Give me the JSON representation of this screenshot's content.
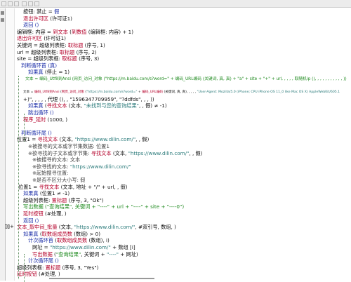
{
  "editor": {
    "fold_marker": "加+",
    "colors": {
      "keyword": "#111111",
      "function": "#b4002a",
      "flow": "#1d2fa8",
      "comment_green": "#1e8a1e",
      "string": "#2a7a7a"
    },
    "lines": [
      {
        "i": 11,
        "s": [
          {
            "t": "按钮: 禁止 = ",
            "c": "k"
          },
          {
            "t": "假",
            "c": "b"
          }
        ]
      },
      {
        "i": 11,
        "s": [
          {
            "t": "退出许可区",
            "c": "f"
          },
          {
            "t": " (许可证1)",
            "c": "k"
          }
        ]
      },
      {
        "i": 11,
        "s": [
          {
            "t": "返回 ()",
            "c": "b"
          }
        ]
      },
      {
        "i": 2,
        "s": [
          {
            "t": "编辑框: 内容 = ",
            "c": "k"
          },
          {
            "t": "到文本",
            "c": "f"
          },
          {
            "t": " (",
            "c": "k"
          },
          {
            "t": "到数值",
            "c": "f"
          },
          {
            "t": " (编辑框: 内容) + 1)",
            "c": "k"
          }
        ]
      },
      {
        "i": 2,
        "s": [
          {
            "t": "退出许可区",
            "c": "f"
          },
          {
            "t": " (许可证1)",
            "c": "k"
          }
        ]
      },
      {
        "i": 2,
        "s": [
          {
            "t": "关键词 = 超级列表框: ",
            "c": "k"
          },
          {
            "t": "取标题",
            "c": "f"
          },
          {
            "t": " (序号, 1)",
            "c": "k"
          }
        ]
      },
      {
        "i": 2,
        "s": [
          {
            "t": "url = 超级列表框: ",
            "c": "k"
          },
          {
            "t": "取标题",
            "c": "f"
          },
          {
            "t": " (序号, 2)",
            "c": "k"
          }
        ]
      },
      {
        "i": 2,
        "s": [
          {
            "t": "site = 超级列表框: ",
            "c": "k"
          },
          {
            "t": "取标题",
            "c": "f"
          },
          {
            "t": " (序号, 3)",
            "c": "k"
          }
        ]
      },
      {
        "i": 8,
        "s": [
          {
            "t": "判断循环首 (真)",
            "c": "b"
          }
        ]
      },
      {
        "i": 18,
        "s": [
          {
            "t": "如果真",
            "c": "b"
          },
          {
            "t": " (停止 = 1)",
            "c": "k"
          }
        ]
      },
      {
        "i": 14,
        "s": [
          {
            "t": "文本 = 编码_Utf8到Ansi (网页_访问_对象 (\"https://m.baidu.com/s?word=\" + 编码_URL编码 (关键词, 真, 真) + \"a\" + site + \"+\" + url, , , , , 取随机ip (), , , , , , , , , , , ))",
            "c": "g"
          }
        ]
      },
      {
        "i": 0,
        "s": []
      },
      {
        "i": 11,
        "s": [
          {
            "t": "文本 = ",
            "c": "k"
          },
          {
            "t": "编码_Utf8到Ansi",
            "c": "f"
          },
          {
            "t": " (",
            "c": "k"
          },
          {
            "t": "网页_访问_对象",
            "c": "f"
          },
          {
            "t": " (",
            "c": "k"
          },
          {
            "t": "\"https://m.baidu.com/s?word=\"",
            "c": "s"
          },
          {
            "t": " + ",
            "c": "k"
          },
          {
            "t": "编码_URL编码",
            "c": "f"
          },
          {
            "t": " (关键词, 真, 真), , , , , ",
            "c": "k"
          },
          {
            "t": "\"User-Agent: Mozilla/5.0 (iPhone; CPU iPhone OS 11_0 like Mac OS X) AppleWebKit/605.1",
            "c": "s"
          }
        ]
      },
      {
        "i": 11,
        "s": [
          {
            "t": "+)\", , , , , 代理 (), , \"1596347709959\", \"?ddfds\", , , ))",
            "c": "k"
          }
        ]
      },
      {
        "i": 18,
        "s": [
          {
            "t": "如果真",
            "c": "b"
          },
          {
            "t": " (",
            "c": "k"
          },
          {
            "t": "寻找文本",
            "c": "f"
          },
          {
            "t": " (文本, ",
            "c": "k"
          },
          {
            "t": "\"未找到与您的查询结果\"",
            "c": "s"
          },
          {
            "t": ", , 假) ≠ -1)",
            "c": "k"
          }
        ]
      },
      {
        "i": 18,
        "s": [
          {
            "t": "跳出循环 ()",
            "c": "b"
          }
        ]
      },
      {
        "i": 11,
        "s": [
          {
            "t": "程序_延时",
            "c": "f"
          },
          {
            "t": " (1000, )",
            "c": "k"
          }
        ]
      },
      {
        "i": 0,
        "s": []
      },
      {
        "i": 8,
        "s": [
          {
            "t": "判断循环尾 ()",
            "c": "b"
          }
        ]
      },
      {
        "i": 2,
        "s": [
          {
            "t": "位置1 = ",
            "c": "k"
          },
          {
            "t": "寻找文本",
            "c": "f"
          },
          {
            "t": " (文本, ",
            "c": "k"
          },
          {
            "t": "\"https://www.dilin.com/\"",
            "c": "s"
          },
          {
            "t": ", , 假)",
            "c": "k"
          }
        ]
      },
      {
        "i": 18,
        "s": [
          {
            "t": "※被搜寻的文本或字节集数据: 位置1",
            "c": "cm"
          }
        ]
      },
      {
        "i": 18,
        "s": [
          {
            "t": "※欲寻找的子文本或字节集: ",
            "c": "cm"
          },
          {
            "t": "寻找文本",
            "c": "f"
          },
          {
            "t": " (文本, ",
            "c": "k"
          },
          {
            "t": "\"https://www.dilin.com/\"",
            "c": "s"
          },
          {
            "t": ", , 假)",
            "c": "k"
          }
        ]
      },
      {
        "i": 24,
        "s": [
          {
            "t": "※被搜寻的文本: 文本",
            "c": "cm"
          }
        ]
      },
      {
        "i": 24,
        "s": [
          {
            "t": "※欲寻找的文本: ",
            "c": "cm"
          },
          {
            "t": "\"https://www.dilin.com/\"",
            "c": "s"
          }
        ]
      },
      {
        "i": 24,
        "s": [
          {
            "t": "※起始搜寻位置:",
            "c": "cm"
          }
        ]
      },
      {
        "i": 24,
        "s": [
          {
            "t": "※是否不区分大小写: 假",
            "c": "cm"
          }
        ]
      },
      {
        "i": 4,
        "s": [
          {
            "t": "位置1 = ",
            "c": "k"
          },
          {
            "t": "寻找文本",
            "c": "f"
          },
          {
            "t": " (文本, 地址 + \"/\" + url, , 假)",
            "c": "k"
          }
        ]
      },
      {
        "i": 11,
        "s": [
          {
            "t": "如果真",
            "c": "b"
          },
          {
            "t": " (位置1 ≠ -1)",
            "c": "k"
          }
        ]
      },
      {
        "i": 11,
        "s": [
          {
            "t": "超级列表框: ",
            "c": "k"
          },
          {
            "t": "置标题",
            "c": "f"
          },
          {
            "t": " (序号, 3, \"Ok\")",
            "c": "k"
          }
        ]
      },
      {
        "i": 11,
        "s": [
          {
            "t": "写出数据 (\"查询结果\", 关键词 + \"----\" + url + \"----\" + site + \"----0\")",
            "c": "g"
          }
        ]
      },
      {
        "i": 11,
        "s": [
          {
            "t": "延时按钮",
            "c": "f"
          },
          {
            "t": " (#处理, )",
            "c": "k"
          }
        ]
      },
      {
        "i": 11,
        "s": [
          {
            "t": "返回 ()",
            "c": "b"
          }
        ]
      },
      {
        "i": 2,
        "s": [
          {
            "t": "文本_取中间_批量",
            "c": "f"
          },
          {
            "t": " (文本, ",
            "c": "k"
          },
          {
            "t": "\"https://www.dilin.com/\"",
            "c": "s"
          },
          {
            "t": ", #双引号, 数组, )",
            "c": "k"
          }
        ]
      },
      {
        "i": 11,
        "s": [
          {
            "t": "如果真",
            "c": "b"
          },
          {
            "t": " (",
            "c": "k"
          },
          {
            "t": "取数组成员数",
            "c": "f"
          },
          {
            "t": " (数组) > 0)",
            "c": "k"
          }
        ]
      },
      {
        "i": 18,
        "s": [
          {
            "t": "计次循环首",
            "c": "b"
          },
          {
            "t": " (",
            "c": "k"
          },
          {
            "t": "取数组成员数",
            "c": "f"
          },
          {
            "t": " (数组), i)",
            "c": "k"
          }
        ]
      },
      {
        "i": 24,
        "s": [
          {
            "t": "网址 = ",
            "c": "k"
          },
          {
            "t": "\"https://www.dilin.com/\"",
            "c": "s"
          },
          {
            "t": " + 数组 [i]",
            "c": "k"
          }
        ]
      },
      {
        "i": 24,
        "s": [
          {
            "t": "写出数据",
            "c": "f"
          },
          {
            "t": " (",
            "c": "k"
          },
          {
            "t": "\"查询结果\"",
            "c": "g"
          },
          {
            "t": ", 关键词 + ",
            "c": "k"
          },
          {
            "t": "\"----\"",
            "c": "s"
          },
          {
            "t": " + 网址)",
            "c": "k"
          }
        ]
      },
      {
        "i": 18,
        "s": [
          {
            "t": "计次循环尾 ()",
            "c": "b"
          }
        ]
      },
      {
        "i": 2,
        "s": [
          {
            "t": "超级列表框: ",
            "c": "k"
          },
          {
            "t": "置标题",
            "c": "f"
          },
          {
            "t": " (序号, 3, \"Yes\")",
            "c": "k"
          }
        ]
      },
      {
        "i": 2,
        "s": [
          {
            "t": "延时按钮",
            "c": "f"
          },
          {
            "t": " (#处理, )",
            "c": "k"
          }
        ]
      }
    ]
  }
}
